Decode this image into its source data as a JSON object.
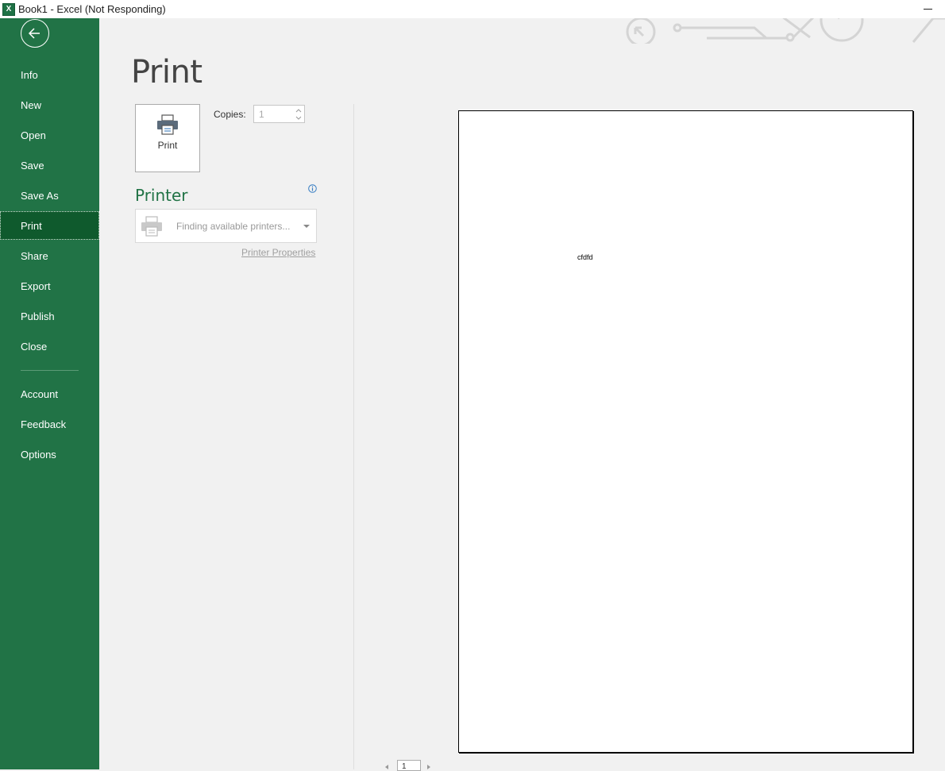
{
  "window": {
    "title": "Book1 - Excel (Not Responding)",
    "icon": "excel-icon"
  },
  "sidebar": {
    "back_icon": "back-arrow-icon",
    "items": [
      {
        "label": "Info"
      },
      {
        "label": "New"
      },
      {
        "label": "Open"
      },
      {
        "label": "Save"
      },
      {
        "label": "Save As"
      },
      {
        "label": "Print",
        "active": true
      },
      {
        "label": "Share"
      },
      {
        "label": "Export"
      },
      {
        "label": "Publish"
      },
      {
        "label": "Close"
      },
      {
        "label": "Account"
      },
      {
        "label": "Feedback"
      },
      {
        "label": "Options"
      }
    ]
  },
  "main": {
    "title": "Print",
    "print_button_label": "Print",
    "copies_label": "Copies:",
    "copies_value": "1",
    "printer_heading": "Printer",
    "printer_placeholder": "Finding available printers...",
    "printer_properties": "Printer Properties"
  },
  "preview": {
    "cell_text": "cfdfd",
    "page_number": "1"
  },
  "colors": {
    "brand": "#217346",
    "active_nav": "#0f5a2d"
  }
}
